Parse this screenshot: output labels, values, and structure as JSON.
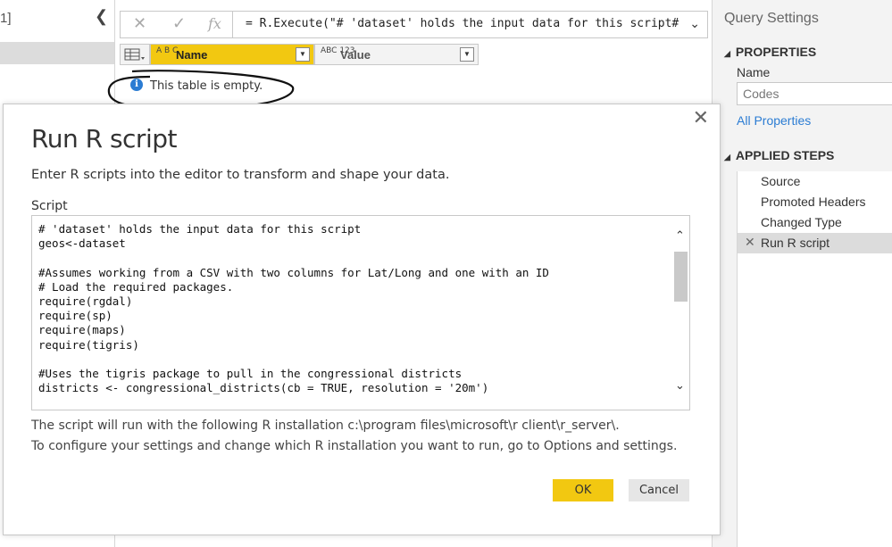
{
  "left_pane": {
    "queries_label_fragment": "1]"
  },
  "formula_bar": {
    "cancel_glyph": "✕",
    "commit_glyph": "✓",
    "fx_label": "fx",
    "formula": "= R.Execute(\"# 'dataset' holds the input data for this script#"
  },
  "grid": {
    "columns": [
      {
        "type_glyph": "A B C",
        "name": "Name"
      },
      {
        "type_glyph": "ABC 123",
        "name": "Value"
      }
    ],
    "empty_message": "This table is empty."
  },
  "query_settings": {
    "title": "Query Settings",
    "properties_heading": "PROPERTIES",
    "name_label": "Name",
    "name_value": "Codes",
    "all_properties_link": "All Properties",
    "applied_steps_heading": "APPLIED STEPS",
    "steps": [
      "Source",
      "Promoted Headers",
      "Changed Type",
      "Run R script"
    ],
    "active_step": "Run R script"
  },
  "dialog": {
    "title": "Run R script",
    "description": "Enter R scripts into the editor to transform and shape your data.",
    "script_label": "Script",
    "script": "# 'dataset' holds the input data for this script\ngeos<-dataset\n\n#Assumes working from a CSV with two columns for Lat/Long and one with an ID\n# Load the required packages.\nrequire(rgdal)\nrequire(sp)\nrequire(maps)\nrequire(tigris)\n\n#Uses the tigris package to pull in the congressional districts\ndistricts <- congressional_districts(cb = TRUE, resolution = '20m')",
    "note_install": "The script will run with the following R installation c:\\program files\\microsoft\\r client\\r_server\\.",
    "note_configure": "To configure your settings and change which R installation you want to run, go to Options and settings.",
    "ok_label": "OK",
    "cancel_label": "Cancel"
  },
  "colors": {
    "accent_yellow": "#f2c811",
    "link_blue": "#2b7cd3"
  }
}
